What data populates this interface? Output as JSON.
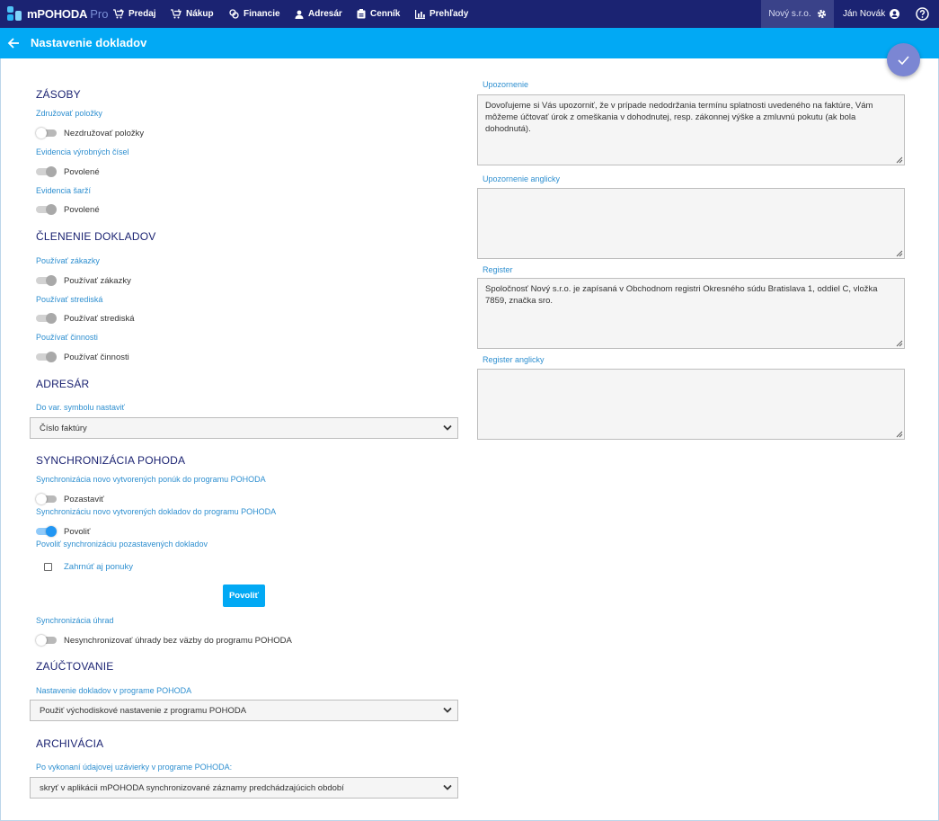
{
  "app": {
    "name": "mPOHODA",
    "edition": "Pro"
  },
  "nav": [
    {
      "label": "Predaj",
      "icon": "cart-plus-icon"
    },
    {
      "label": "Nákup",
      "icon": "cart-in-icon"
    },
    {
      "label": "Financie",
      "icon": "coins-icon"
    },
    {
      "label": "Adresár",
      "icon": "person-icon"
    },
    {
      "label": "Cenník",
      "icon": "pricelist-icon"
    },
    {
      "label": "Prehľady",
      "icon": "bar-chart-icon"
    }
  ],
  "header": {
    "company": "Nový s.r.o.",
    "user": "Ján Novák"
  },
  "page": {
    "title": "Nastavenie dokladov"
  },
  "colors": {
    "topbar": "#1b2372",
    "accent": "#02a9f4",
    "fab": "#7b86d3",
    "heading": "#1b2372",
    "label": "#2e8fd0"
  },
  "left": {
    "zasoby": {
      "heading": "ZÁSOBY",
      "zdruzovat": {
        "label": "Združovať položky",
        "switch_text": "Nezdružovať položky",
        "state": "off"
      },
      "vyrobne": {
        "label": "Evidencia výrobných čísel",
        "switch_text": "Povolené",
        "state": "on-disabled"
      },
      "sarze": {
        "label": "Evidencia šarží",
        "switch_text": "Povolené",
        "state": "on-disabled"
      }
    },
    "clenenie": {
      "heading": "ČLENENIE DOKLADOV",
      "zakazky": {
        "label": "Používať zákazky",
        "switch_text": "Používať zákazky",
        "state": "on-disabled"
      },
      "strediska": {
        "label": "Používať strediská",
        "switch_text": "Používať strediská",
        "state": "on-disabled"
      },
      "cinnosti": {
        "label": "Používať činnosti",
        "switch_text": "Používať činnosti",
        "state": "on-disabled"
      }
    },
    "adresar": {
      "heading": "ADRESÁR",
      "label": "Do var. symbolu nastaviť",
      "value": "Číslo faktúry"
    },
    "sync": {
      "heading": "SYNCHRONIZÁCIA POHODA",
      "ponuky": {
        "label": "Synchronizácia novo vytvorených ponúk do programu POHODA",
        "switch_text": "Pozastaviť",
        "state": "off"
      },
      "doklady": {
        "label": "Synchronizáciu novo vytvorených dokladov do programu POHODA",
        "switch_text": "Povoliť",
        "state": "on"
      },
      "pozastavene": {
        "label": "Povoliť synchronizáciu pozastavených dokladov",
        "checkbox_text": "Zahrnúť aj ponuky",
        "checked": false,
        "button": "Povoliť"
      },
      "uhrady": {
        "label": "Synchronizácia úhrad",
        "switch_text": "Nesynchronizovať úhrady bez väzby do programu POHODA",
        "state": "off"
      }
    },
    "zauctovanie": {
      "heading": "ZAÚČTOVANIE",
      "label": "Nastavenie dokladov v programe POHODA",
      "value": "Použiť východiskové nastavenie z programu POHODA"
    },
    "archivacia": {
      "heading": "ARCHIVÁCIA",
      "label": "Po vykonaní údajovej uzávierky v programe POHODA:",
      "value": "skryť v aplikácii mPOHODA synchronizované záznamy predchádzajúcich období"
    }
  },
  "right": {
    "upozornenie": {
      "label": "Upozornenie",
      "text": "Dovoľujeme si Vás upozorniť, že v prípade nedodržania termínu splatnosti uvedeného na faktúre, Vám môžeme účtovať úrok z omeškania v dohodnutej, resp. zákonnej výške a zmluvnú pokutu (ak bola dohodnutá)."
    },
    "upozornenie_en": {
      "label": "Upozornenie anglicky",
      "text": ""
    },
    "register": {
      "label": "Register",
      "text": "Spoločnosť Nový s.r.o. je zapísaná v Obchodnom registri Okresného súdu Bratislava 1, oddiel C, vložka 7859, značka sro."
    },
    "register_en": {
      "label": "Register anglicky",
      "text": ""
    }
  }
}
